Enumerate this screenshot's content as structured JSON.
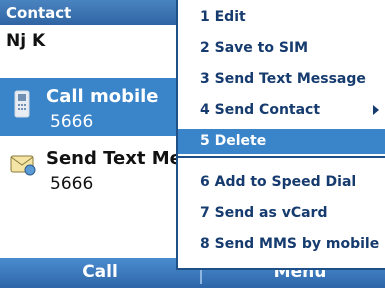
{
  "title_bar": {
    "title": "Contact"
  },
  "contact": {
    "name": "Nj K"
  },
  "items": [
    {
      "label": "Call mobile",
      "value": "5666",
      "icon": "phone-icon",
      "selected": true
    },
    {
      "label": "Send Text Me",
      "value": "5666",
      "icon": "text-message-icon",
      "selected": false
    }
  ],
  "softkeys": {
    "left": "Call",
    "right": "Menu"
  },
  "menu": {
    "items": [
      {
        "label": "1 Edit"
      },
      {
        "label": "2 Save to SIM"
      },
      {
        "label": "3 Send Text Message"
      },
      {
        "label": "4 Send Contact",
        "submenu": true
      },
      {
        "label": "5 Delete",
        "selected": true
      },
      {
        "label": "6 Add to Speed Dial"
      },
      {
        "label": "7 Send as vCard"
      },
      {
        "label": "8 Send MMS by mobile"
      }
    ]
  },
  "colors": {
    "accent": "#3a84c9",
    "title_bar": "#2f64a3",
    "menu_text": "#163b6e"
  }
}
